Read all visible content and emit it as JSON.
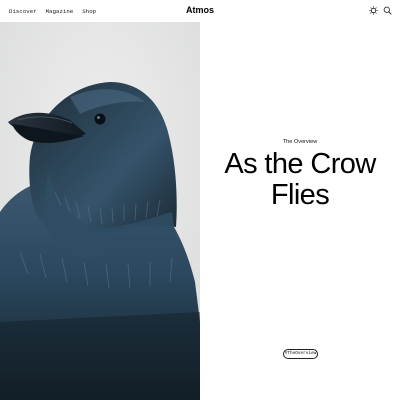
{
  "header": {
    "nav": [
      "Discover",
      "Magazine",
      "Shop"
    ],
    "brand": "Atmos",
    "icons": [
      "theme-toggle-icon",
      "search-icon"
    ]
  },
  "hero": {
    "image_subject": "raven",
    "eyebrow": "The Overview",
    "title_line1": "As the Crow",
    "title_line2": "Flies",
    "hashtag": "#TheOverview"
  },
  "colors": {
    "background": "#ffffff",
    "image_background": "#e6e7e7",
    "bird_dark": "#17242f",
    "bird_blue": "#2b4860",
    "text": "#000000"
  }
}
